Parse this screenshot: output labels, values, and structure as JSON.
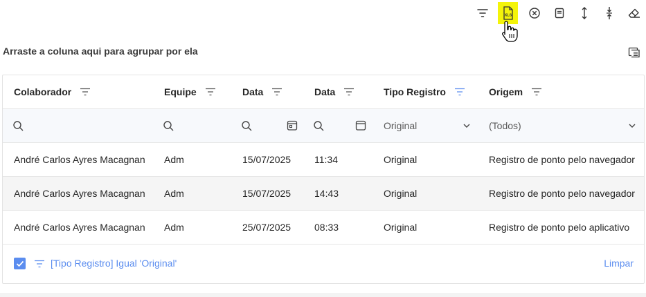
{
  "toolbar": {
    "buttons": [
      {
        "icon": "filter-icon"
      },
      {
        "icon": "export-xls-icon",
        "badge": "XLS"
      },
      {
        "icon": "clear-circle-icon"
      },
      {
        "icon": "document-icon"
      },
      {
        "icon": "expand-vertical-icon"
      },
      {
        "icon": "collapse-vertical-icon"
      },
      {
        "icon": "eraser-icon"
      }
    ],
    "highlight_color": "#f4f40a"
  },
  "group_panel": {
    "text": "Arraste a coluna aqui para agrupar por ela"
  },
  "grid": {
    "columns": [
      {
        "label": "Colaborador"
      },
      {
        "label": "Equipe"
      },
      {
        "label": "Data"
      },
      {
        "label": "Data"
      },
      {
        "label": "Tipo Registro",
        "filter_active": true
      },
      {
        "label": "Origem"
      }
    ],
    "filter_row": {
      "tipo_registro_value": "Original",
      "origem_value": "(Todos)"
    },
    "rows": [
      {
        "colaborador": "André Carlos Ayres Macagnan",
        "equipe": "Adm",
        "data": "15/07/2025",
        "hora": "11:34",
        "tipo": "Original",
        "origem": "Registro de ponto pelo navegador"
      },
      {
        "colaborador": "André Carlos Ayres Macagnan",
        "equipe": "Adm",
        "data": "15/07/2025",
        "hora": "14:43",
        "tipo": "Original",
        "origem": "Registro de ponto pelo navegador"
      },
      {
        "colaborador": "André Carlos Ayres Macagnan",
        "equipe": "Adm",
        "data": "25/07/2025",
        "hora": "08:33",
        "tipo": "Original",
        "origem": "Registro de ponto pelo aplicativo"
      }
    ]
  },
  "filter_panel": {
    "enabled": true,
    "expression": "[Tipo Registro] Igual 'Original'",
    "clear_label": "Limpar"
  },
  "colors": {
    "accent": "#5b8def",
    "active_filter_icon": "#5b8def"
  }
}
